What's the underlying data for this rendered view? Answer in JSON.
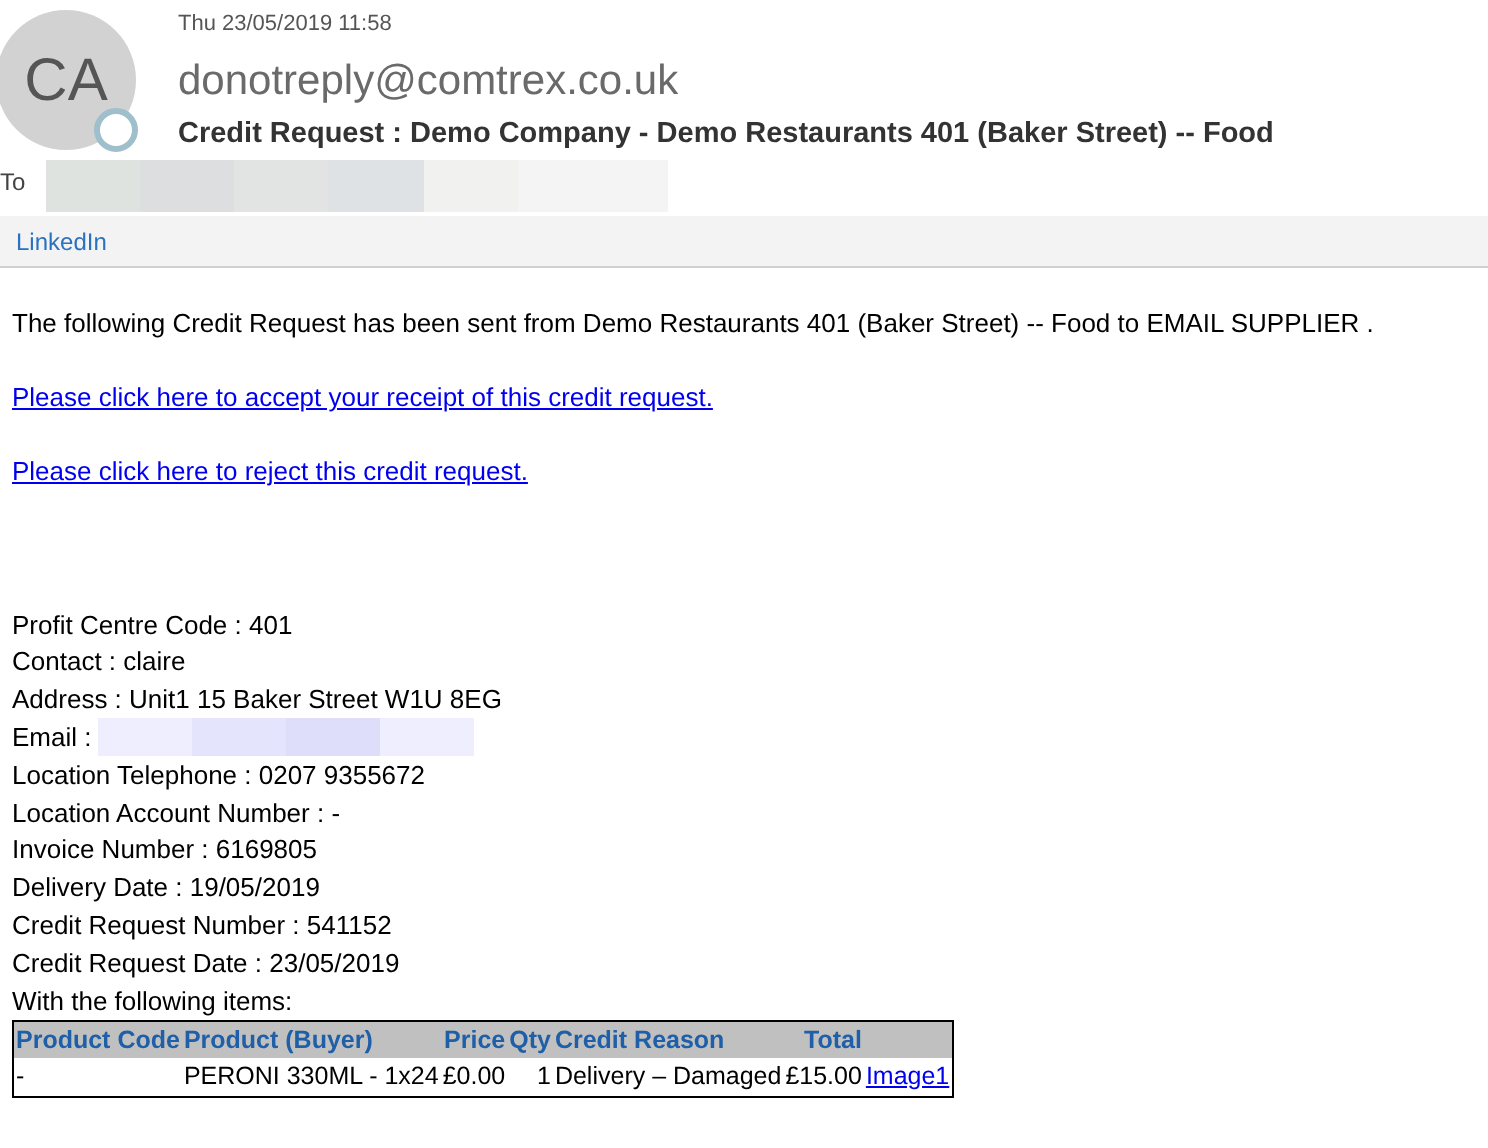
{
  "header": {
    "avatar_initials": "CA",
    "date": "Thu 23/05/2019 11:58",
    "sender": "donotreply@comtrex.co.uk",
    "subject": "Credit Request : Demo Company - Demo Restaurants 401 (Baker Street) -- Food",
    "to_label": "To"
  },
  "toolbar": {
    "links": [
      "LinkedIn"
    ]
  },
  "body": {
    "intro": "The following Credit Request has been sent from Demo Restaurants 401 (Baker Street) -- Food to EMAIL SUPPLIER .",
    "links": [
      "Please click here to accept your receipt of this credit request.",
      "Please click here to reject this credit request."
    ],
    "details": [
      {
        "text": "Profit Centre Code : 401"
      },
      {
        "text": "Contact : claire"
      },
      {
        "text": "Address : Unit1 15 Baker Street W1U 8EG"
      },
      {
        "text": "Email :",
        "redacted": true
      },
      {
        "text": "Location Telephone : 0207 9355672"
      },
      {
        "text": "Location Account Number : -"
      },
      {
        "text": "Invoice Number : 6169805"
      },
      {
        "text": "Delivery Date : 19/05/2019"
      },
      {
        "text": "Credit Request Number : 541152"
      },
      {
        "text": "Credit Request Date : 23/05/2019"
      },
      {
        "text": "With the following items:"
      }
    ],
    "table": {
      "columns": [
        "Product Code",
        "Product (Buyer)",
        "Price",
        "Qty",
        "Credit Reason",
        "Total"
      ],
      "rows": [
        {
          "cells": [
            "-",
            "PERONI 330ML - 1x24",
            "£0.00",
            "1",
            "Delivery – Damaged",
            "£15.00"
          ],
          "link": "Image1"
        }
      ]
    }
  }
}
